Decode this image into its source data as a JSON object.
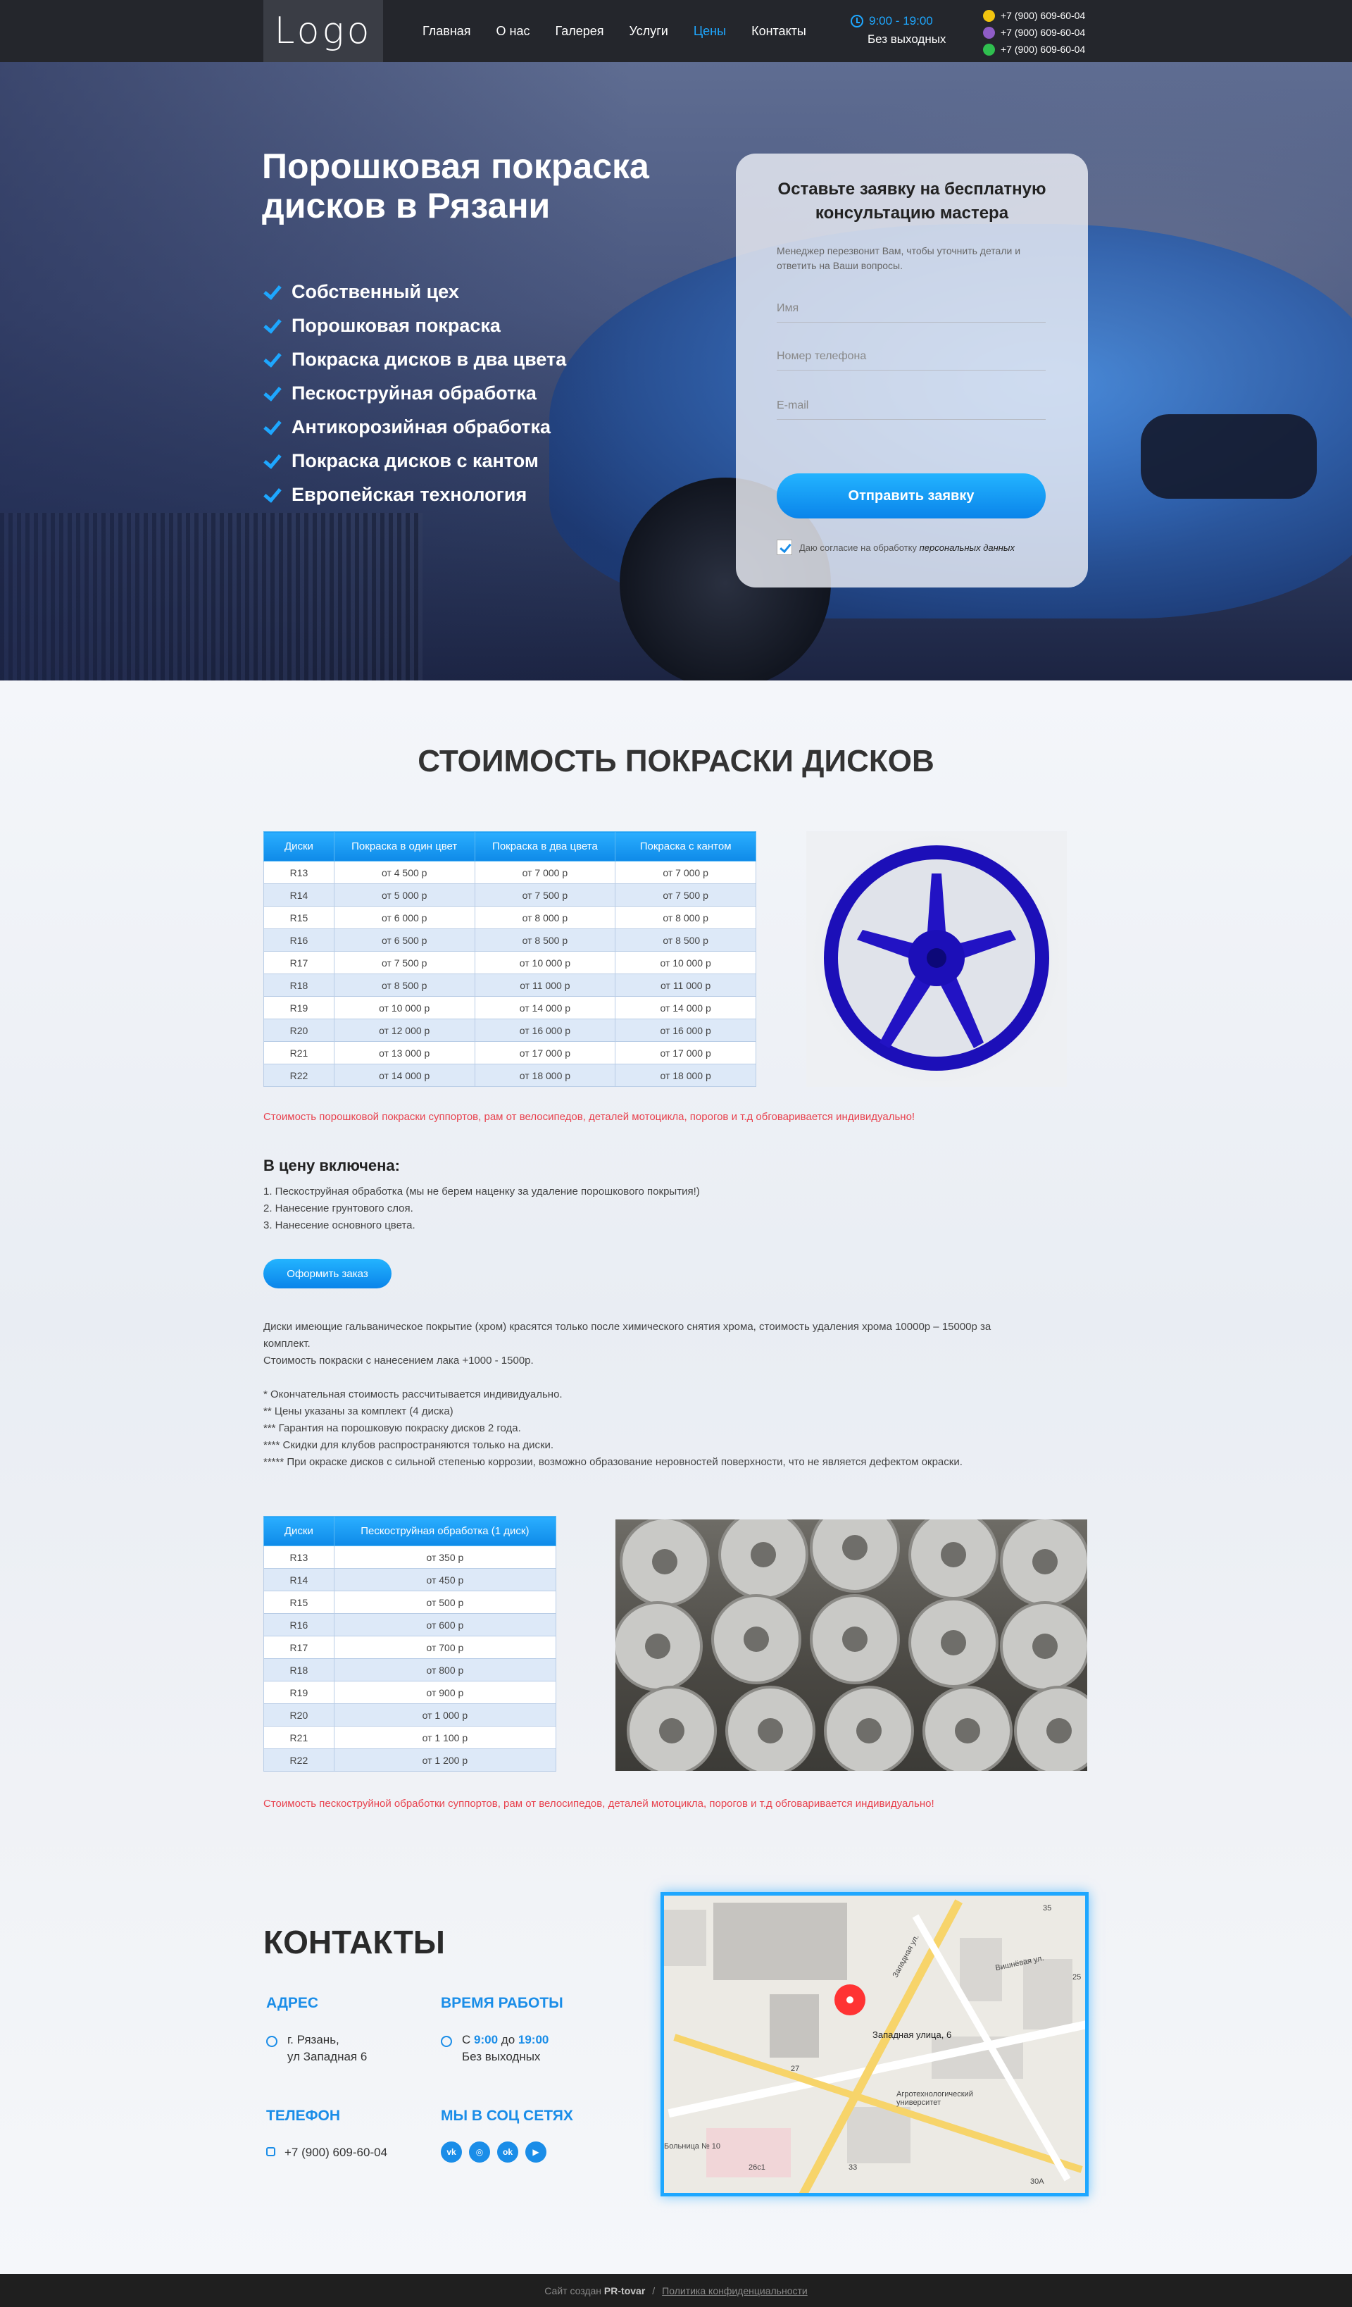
{
  "header": {
    "logo": "Logo",
    "nav": [
      "Главная",
      "О нас",
      "Галерея",
      "Услуги",
      "Цены",
      "Контакты"
    ],
    "active_nav": "Цены",
    "hours": "9:00 - 19:00",
    "days": "Без выходных",
    "phones": [
      "+7 (900) 609-60-04",
      "+7 (900) 609-60-04",
      "+7 (900) 609-60-04"
    ]
  },
  "hero": {
    "title_line1": "Порошковая покраска",
    "title_line2": "дисков в Рязани",
    "features": [
      "Собственный цех",
      "Порошковая покраска",
      "Покраска дисков в два цвета",
      "Пескоструйная обработка",
      "Антикорозийная обработка",
      "Покраска дисков с кантом",
      "Европейская технология"
    ]
  },
  "form": {
    "title_line1": "Оставьте заявку на бесплатную",
    "title_line2": "консультацию мастера",
    "note": "Менеджер перезвонит Вам, чтобы уточнить детали и ответить на Ваши вопросы.",
    "name_placeholder": "Имя",
    "phone_placeholder": "Номер телефона",
    "email_placeholder": "E-mail",
    "submit": "Отправить заявку",
    "consent_text": "Даю согласие на обработку",
    "consent_link": "персональных данных"
  },
  "prices": {
    "title": "СТОИМОСТЬ ПОКРАСКИ ДИСКОВ",
    "headers": [
      "Диски",
      "Покраска в один цвет",
      "Покраска в два цвета",
      "Покраска с кантом"
    ],
    "rows": [
      [
        "R13",
        "от 4 500 р",
        "от 7 000 р",
        "от 7 000 р"
      ],
      [
        "R14",
        "от 5 000 р",
        "от 7 500 р",
        "от 7 500 р"
      ],
      [
        "R15",
        "от 6 000 р",
        "от 8 000 р",
        "от 8 000 р"
      ],
      [
        "R16",
        "от 6 500 р",
        "от 8 500 р",
        "от 8 500 р"
      ],
      [
        "R17",
        "от 7 500 р",
        "от 10 000 р",
        "от 10 000 р"
      ],
      [
        "R18",
        "от 8 500 р",
        "от 11 000 р",
        "от 11 000 р"
      ],
      [
        "R19",
        "от 10 000 р",
        "от 14 000 р",
        "от 14 000 р"
      ],
      [
        "R20",
        "от 12 000 р",
        "от 16 000 р",
        "от 16 000 р"
      ],
      [
        "R21",
        "от 13 000 р",
        "от 17 000 р",
        "от 17 000 р"
      ],
      [
        "R22",
        "от 14 000 р",
        "от 18 000 р",
        "от 18 000 р"
      ]
    ],
    "note": "Стоимость порошковой покраски суппортов, рам от велосипедов, деталей мотоцикла, порогов и т.д обговаривается индивидуально!",
    "included_title": "В цену включена:",
    "included": [
      "1. Пескоструйная обработка (мы не берем наценку за удаление порошкового покрытия!)",
      "2. Нанесение грунтового слоя.",
      "3. Нанесение основного цвета."
    ],
    "order_button": "Оформить заказ",
    "info1": "Диски имеющие гальваническое покрытие (хром) красятся только после химического снятия хрома, стоимость удаления хрома 10000р – 15000р за комплект.",
    "info2": "Стоимость покраски с нанесением лака +1000 - 1500р.",
    "footnotes": [
      "* Окончательная стоимость рассчитывается индивидуально.",
      "** Цены указаны за комплект (4 диска)",
      "*** Гарантия на порошковую покраску дисков 2 года.",
      "**** Скидки для клубов распространяются только на диски.",
      "***** При окраске дисков с сильной степенью коррозии,  возможно образование неровностей поверхности, что не является дефектом окраски."
    ]
  },
  "sandblast": {
    "headers": [
      "Диски",
      "Пескоструйная обработка (1 диск)"
    ],
    "rows": [
      [
        "R13",
        "от 350 р"
      ],
      [
        "R14",
        "от 450 р"
      ],
      [
        "R15",
        "от 500 р"
      ],
      [
        "R16",
        "от 600 р"
      ],
      [
        "R17",
        "от 700 р"
      ],
      [
        "R18",
        "от 800 р"
      ],
      [
        "R19",
        "от 900 р"
      ],
      [
        "R20",
        "от 1 000 р"
      ],
      [
        "R21",
        "от 1 100 р"
      ],
      [
        "R22",
        "от 1 200 р"
      ]
    ],
    "note": "Стоимость пескоструйной обработки суппортов, рам от велосипедов, деталей мотоцикла, порогов и т.д обговаривается индивидуально!"
  },
  "contacts": {
    "title": "КОНТАКТЫ",
    "address_head": "АДРЕС",
    "address_line1": "г. Рязань,",
    "address_line2": "ул Западная 6",
    "hours_head": "ВРЕМЯ РАБОТЫ",
    "hours_from_label": "С",
    "hours_from": "9:00",
    "hours_to_label": "до",
    "hours_to": "19:00",
    "hours_days": "Без выходных",
    "phone_head": "ТЕЛЕФОН",
    "phone": "+7 (900) 609-60-04",
    "social_head": "МЫ В СОЦ СЕТЯХ",
    "social_icons": [
      "vk-icon",
      "instagram-icon",
      "odnoklassniki-icon",
      "youtube-icon"
    ]
  },
  "map": {
    "marker_label": "Западная улица, 6",
    "labels": [
      "Агротехнологический университет",
      "Больница № 10",
      "Западная ул.",
      "Вишнёвая ул.",
      "27",
      "26с1",
      "33",
      "30А",
      "35",
      "25"
    ]
  },
  "footer": {
    "created": "Сайт создан",
    "brand": "PR-tovar",
    "sep": "/",
    "policy": "Политика конфиденциальности"
  }
}
